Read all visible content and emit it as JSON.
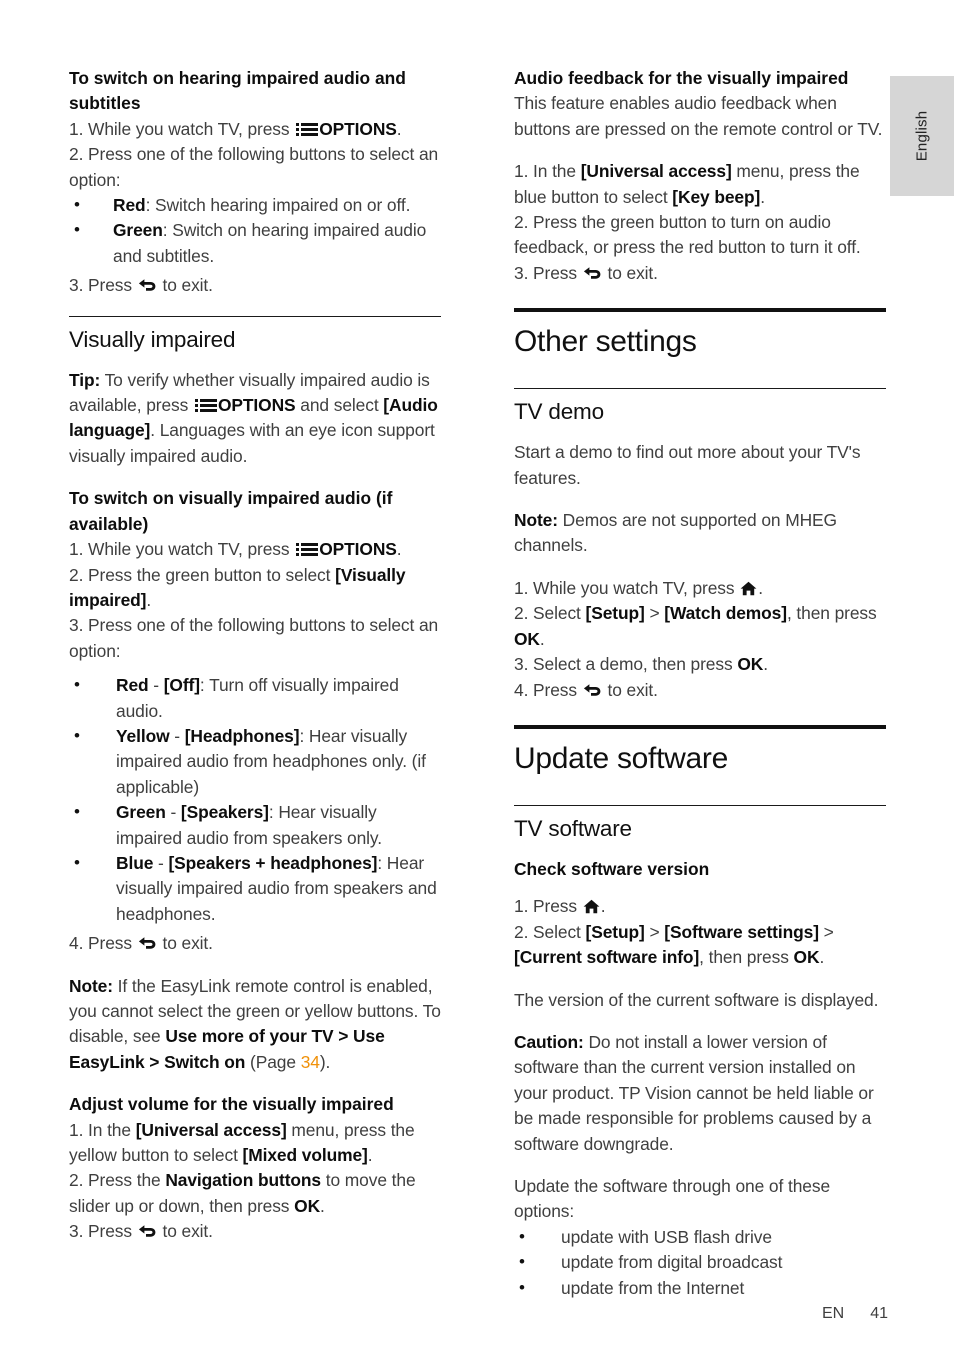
{
  "page": {
    "language_tab": "English",
    "footer_locale": "EN",
    "footer_page_number": "41",
    "link_color": "#f0910a"
  },
  "left_column": {
    "hearing_impaired": {
      "heading": "To switch on hearing impaired audio and subtitles",
      "step1_pre": "1. While you watch TV, press ",
      "step1_icon": "options-icon",
      "step1_bold": "OPTIONS",
      "step1_post": ".",
      "step2": "2. Press one of the following buttons to select an option:",
      "bullets": [
        {
          "bold": "Red",
          "rest": ": Switch hearing impaired on or off."
        },
        {
          "bold": "Green",
          "rest": ": Switch on hearing impaired audio and subtitles."
        }
      ],
      "step3_pre": "3. Press ",
      "step3_icon": "back-arrow-icon",
      "step3_post": " to exit."
    },
    "visually_impaired": {
      "heading": "Visually impaired",
      "tip_label": "Tip:",
      "tip_a": " To verify whether visually impaired audio is available, press ",
      "tip_icon": "options-icon",
      "tip_b": "OPTIONS",
      "tip_c": " and select ",
      "tip_d": "[Audio language]",
      "tip_e": ". Languages with an eye icon support visually impaired audio.",
      "switch_heading": "To switch on visually impaired audio (if available)",
      "step1_pre": "1. While you watch TV, press ",
      "step1_icon": "options-icon",
      "step1_bold": "OPTIONS",
      "step1_post": ".",
      "step2_pre": "2. Press the green button to select ",
      "step2_bold": "[Visually impaired]",
      "step2_post": ".",
      "step3": "3. Press one of the following buttons to select an option:",
      "bullets": [
        {
          "bold1": "Red",
          "sep": " - ",
          "bold2": "[Off]",
          "rest": ": Turn off visually impaired audio."
        },
        {
          "bold1": "Yellow",
          "sep": " - ",
          "bold2": "[Headphones]",
          "rest": ": Hear visually impaired audio from headphones only. (if applicable)"
        },
        {
          "bold1": "Green",
          "sep": " - ",
          "bold2": "[Speakers]",
          "rest": ": Hear visually impaired audio from speakers only."
        },
        {
          "bold1": "Blue",
          "sep": " - ",
          "bold2": "[Speakers + headphones]",
          "rest": ": Hear visually impaired audio from speakers and headphones."
        }
      ],
      "step4_pre": "4. Press ",
      "step4_icon": "back-arrow-icon",
      "step4_post": " to exit.",
      "note_label": "Note:",
      "note_a": " If the EasyLink remote control is enabled, you cannot select the green or yellow buttons. To disable, see ",
      "note_bold": "Use more of your TV > Use EasyLink > Switch on",
      "note_b": " (Page ",
      "note_page": "34",
      "note_c": ")."
    },
    "adjust_volume": {
      "heading": "Adjust volume for the visually impaired",
      "step1_pre": "1. In the ",
      "step1_bold1": "[Universal access]",
      "step1_mid": " menu, press the yellow button to select ",
      "step1_bold2": "[Mixed volume]",
      "step1_post": ".",
      "step2_pre": "2. Press the ",
      "step2_bold1": "Navigation buttons",
      "step2_mid": " to move the slider up or down, then press ",
      "step2_bold2": "OK",
      "step2_post": ".",
      "step3_pre": "3. Press ",
      "step3_icon": "back-arrow-icon",
      "step3_post": " to exit."
    }
  },
  "right_column": {
    "audio_feedback": {
      "heading": "Audio feedback for the visually impaired",
      "intro": "This feature enables audio feedback when buttons are pressed on the remote control or TV.",
      "step1_pre": "1. In the ",
      "step1_bold1": "[Universal access]",
      "step1_mid": " menu, press the blue button to select ",
      "step1_bold2": "[Key beep]",
      "step1_post": ".",
      "step2": "2. Press the green button to turn on audio feedback, or press the red button to turn it off.",
      "step3_pre": "3. Press ",
      "step3_icon": "back-arrow-icon",
      "step3_post": " to exit."
    },
    "other_settings": {
      "heading": "Other settings",
      "tv_demo": {
        "heading": "TV demo",
        "intro": "Start a demo to find out more about your TV's features.",
        "note_label": "Note:",
        "note_text": " Demos are not supported on MHEG channels.",
        "step1_pre": "1. While you watch TV, press ",
        "step1_icon": "home-icon",
        "step1_post": ".",
        "step2_pre": "2. Select ",
        "step2_bold1": "[Setup]",
        "step2_gt": " > ",
        "step2_bold2": "[Watch demos]",
        "step2_mid": ", then press ",
        "step2_bold3": "OK",
        "step2_post": ".",
        "step3_pre": "3. Select a demo, then press ",
        "step3_bold": "OK",
        "step3_post": ".",
        "step4_pre": "4. Press ",
        "step4_icon": "back-arrow-icon",
        "step4_post": " to exit."
      }
    },
    "update_software": {
      "heading": "Update software",
      "tv_software": {
        "heading": "TV software",
        "check_heading": "Check software version",
        "step1_pre": "1. Press ",
        "step1_icon": "home-icon",
        "step1_post": ".",
        "step2_pre": "2. Select ",
        "step2_bold1": "[Setup]",
        "step2_gt1": " > ",
        "step2_bold2": "[Software settings]",
        "step2_gt2": " > ",
        "step2_bold3": "[Current software info]",
        "step2_mid": ", then press ",
        "step2_bold4": "OK",
        "step2_post": ".",
        "version_text": "The version of the current software is displayed.",
        "caution_label": "Caution:",
        "caution_text": " Do not install a lower version of software than the current version installed on your product. TP Vision cannot be held liable or be made responsible for problems caused by a software downgrade.",
        "options_intro": "Update the software through one of these options:",
        "options": [
          "update with USB flash drive",
          "update from digital broadcast",
          "update from the Internet"
        ]
      }
    }
  }
}
